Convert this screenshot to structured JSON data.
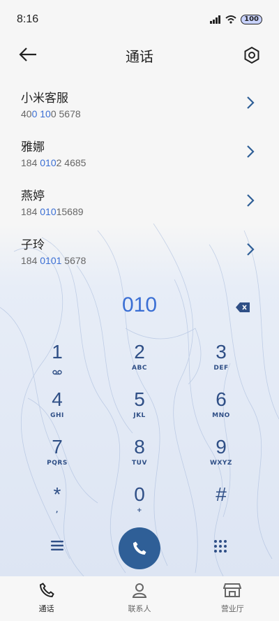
{
  "status": {
    "time": "8:16",
    "battery": "100"
  },
  "header": {
    "title": "通话"
  },
  "contacts": [
    {
      "name": "小米客服",
      "num_pre": "40",
      "num_hl": "0 10",
      "num_post": "0 5678"
    },
    {
      "name": "雅娜",
      "num_pre": "184 ",
      "num_hl": "010",
      "num_post": "2 4685"
    },
    {
      "name": "燕婷",
      "num_pre": "184 ",
      "num_hl": "010",
      "num_post": "15689"
    },
    {
      "name": "子玲",
      "num_pre": "184 ",
      "num_hl": "0101",
      "num_post": " 5678"
    }
  ],
  "dialer": {
    "input": "010",
    "keys": [
      {
        "digit": "1",
        "letters": ""
      },
      {
        "digit": "2",
        "letters": "ABC"
      },
      {
        "digit": "3",
        "letters": "DEF"
      },
      {
        "digit": "4",
        "letters": "GHI"
      },
      {
        "digit": "5",
        "letters": "JKL"
      },
      {
        "digit": "6",
        "letters": "MNO"
      },
      {
        "digit": "7",
        "letters": "PQRS"
      },
      {
        "digit": "8",
        "letters": "TUV"
      },
      {
        "digit": "9",
        "letters": "WXYZ"
      },
      {
        "digit": "*",
        "letters": ","
      },
      {
        "digit": "0",
        "letters": "+"
      },
      {
        "digit": "#",
        "letters": ""
      }
    ]
  },
  "nav": [
    {
      "label": "通话",
      "icon": "phone-icon"
    },
    {
      "label": "联系人",
      "icon": "person-icon"
    },
    {
      "label": "营业厅",
      "icon": "store-icon"
    }
  ],
  "colors": {
    "accent": "#3b6fd4",
    "key_text": "#2f4f86",
    "call_button": "#2f5f97"
  }
}
